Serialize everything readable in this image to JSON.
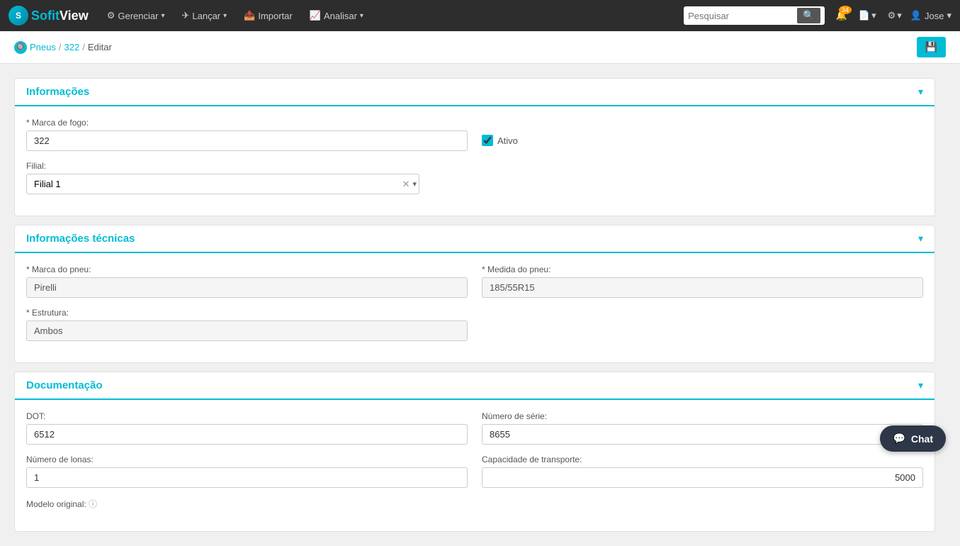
{
  "app": {
    "logo_sofit": "Sofit",
    "logo_view": "View"
  },
  "topnav": {
    "manage_label": "Gerenciar",
    "launch_label": "Lançar",
    "import_label": "Importar",
    "analyze_label": "Analisar",
    "search_placeholder": "Pesquisar",
    "notification_badge": "34",
    "user_name": "Jose"
  },
  "breadcrumb": {
    "root_label": "Pneus",
    "middle_label": "322",
    "current_label": "Editar"
  },
  "sections": {
    "informacoes": {
      "title": "Informações",
      "marca_fogo_label": "* Marca de fogo:",
      "marca_fogo_value": "322",
      "ativo_label": "Ativo",
      "filial_label": "Filial:",
      "filial_value": "Filial 1"
    },
    "informacoes_tecnicas": {
      "title": "Informações técnicas",
      "marca_pneu_label": "* Marca do pneu:",
      "marca_pneu_value": "Pirelli",
      "medida_pneu_label": "* Medida do pneu:",
      "medida_pneu_value": "185/55R15",
      "estrutura_label": "* Estrutura:",
      "estrutura_value": "Ambos"
    },
    "documentacao": {
      "title": "Documentação",
      "dot_label": "DOT:",
      "dot_value": "6512",
      "numero_serie_label": "Número de série:",
      "numero_serie_value": "8655",
      "numero_lonas_label": "Número de lonas:",
      "numero_lonas_value": "1",
      "capacidade_label": "Capacidade de transporte:",
      "capacidade_value": "5000",
      "modelo_original_label": "Modelo original:"
    }
  },
  "chat": {
    "label": "Chat"
  }
}
